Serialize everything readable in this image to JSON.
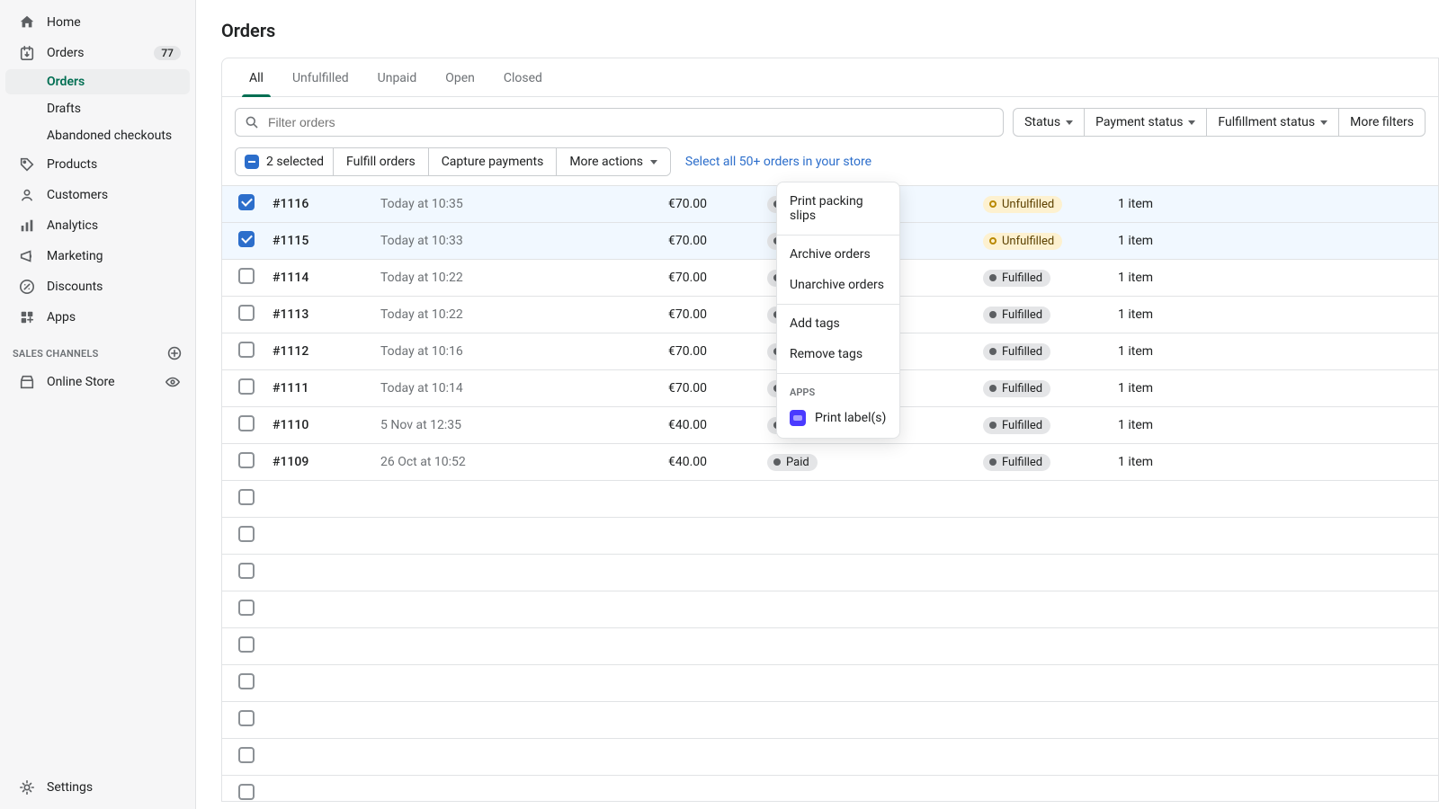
{
  "sidebar": {
    "items": [
      {
        "label": "Home",
        "icon": "home-icon"
      },
      {
        "label": "Orders",
        "icon": "orders-icon",
        "badge": "77",
        "active": false,
        "children": [
          {
            "label": "Orders",
            "active": true
          },
          {
            "label": "Drafts"
          },
          {
            "label": "Abandoned checkouts"
          }
        ]
      },
      {
        "label": "Products",
        "icon": "tag-icon"
      },
      {
        "label": "Customers",
        "icon": "user-icon"
      },
      {
        "label": "Analytics",
        "icon": "analytics-icon"
      },
      {
        "label": "Marketing",
        "icon": "megaphone-icon"
      },
      {
        "label": "Discounts",
        "icon": "discount-icon"
      },
      {
        "label": "Apps",
        "icon": "apps-icon"
      }
    ],
    "section_header": "SALES CHANNELS",
    "channels": [
      {
        "label": "Online Store",
        "icon": "store-icon",
        "has_view": true
      }
    ],
    "footer": {
      "label": "Settings",
      "icon": "settings-icon"
    }
  },
  "page": {
    "title": "Orders"
  },
  "tabs": [
    "All",
    "Unfulfilled",
    "Unpaid",
    "Open",
    "Closed"
  ],
  "active_tab": "All",
  "search": {
    "placeholder": "Filter orders",
    "value": ""
  },
  "filter_buttons": [
    "Status",
    "Payment status",
    "Fulfillment status",
    "More filters"
  ],
  "bulk": {
    "selected_text": "2 selected",
    "actions": [
      "Fulfill orders",
      "Capture payments"
    ],
    "more_label": "More actions",
    "select_all_link": "Select all 50+ orders in your store"
  },
  "dropdown": {
    "items": [
      "Print packing slips",
      "Archive orders",
      "Unarchive orders",
      "Add tags",
      "Remove tags"
    ],
    "apps_header": "APPS",
    "apps": [
      {
        "label": "Print label(s)"
      }
    ]
  },
  "orders": [
    {
      "selected": true,
      "id": "#1116",
      "date": "Today at 10:35",
      "customer": "",
      "total": "€70.00",
      "payment": "Paid",
      "fulfillment": "Unfulfilled",
      "items": "1 item"
    },
    {
      "selected": true,
      "id": "#1115",
      "date": "Today at 10:33",
      "customer": "",
      "total": "€70.00",
      "payment": "Paid",
      "fulfillment": "Unfulfilled",
      "items": "1 item"
    },
    {
      "selected": false,
      "id": "#1114",
      "date": "Today at 10:22",
      "customer": "",
      "total": "€70.00",
      "payment": "Paid",
      "fulfillment": "Fulfilled",
      "items": "1 item"
    },
    {
      "selected": false,
      "id": "#1113",
      "date": "Today at 10:22",
      "customer": "",
      "total": "€70.00",
      "payment": "Paid",
      "fulfillment": "Fulfilled",
      "items": "1 item"
    },
    {
      "selected": false,
      "id": "#1112",
      "date": "Today at 10:16",
      "customer": "",
      "total": "€70.00",
      "payment": "Paid",
      "fulfillment": "Fulfilled",
      "items": "1 item"
    },
    {
      "selected": false,
      "id": "#1111",
      "date": "Today at 10:14",
      "customer": "",
      "total": "€70.00",
      "payment": "Paid",
      "fulfillment": "Fulfilled",
      "items": "1 item"
    },
    {
      "selected": false,
      "id": "#1110",
      "date": "5 Nov at 12:35",
      "customer": "",
      "total": "€40.00",
      "payment": "Paid",
      "fulfillment": "Fulfilled",
      "items": "1 item"
    },
    {
      "selected": false,
      "id": "#1109",
      "date": "26 Oct at 10:52",
      "customer": "",
      "total": "€40.00",
      "payment": "Paid",
      "fulfillment": "Fulfilled",
      "items": "1 item"
    }
  ],
  "empty_rows": 9
}
